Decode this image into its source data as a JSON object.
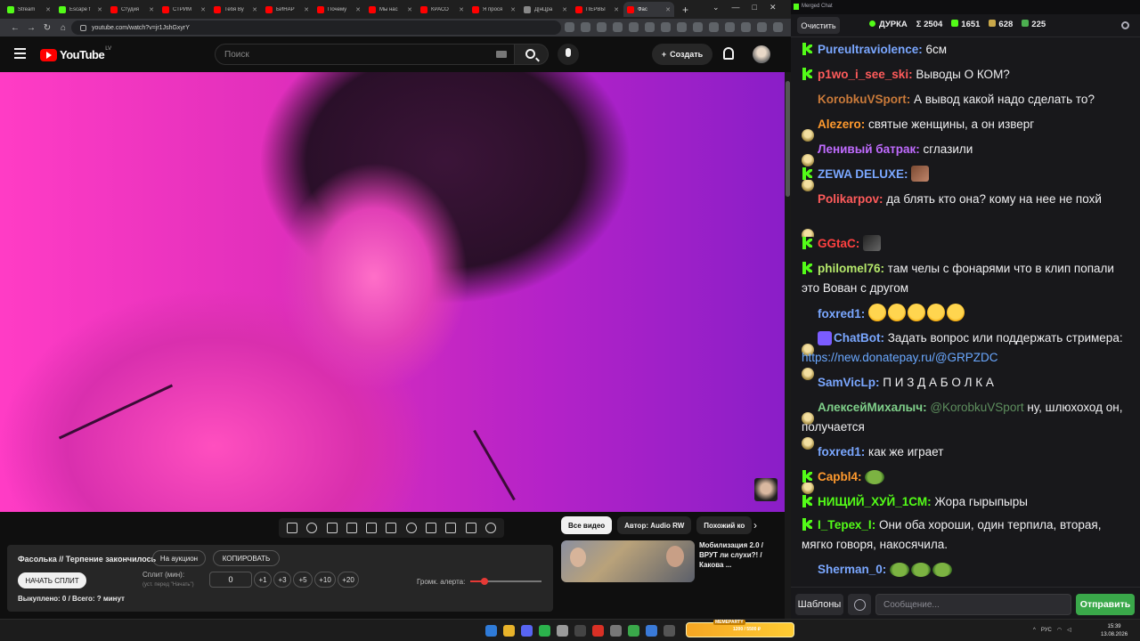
{
  "browser": {
    "tabs": [
      {
        "label": "Stream",
        "color": "#53fc18"
      },
      {
        "label": "Escape f",
        "color": "#53fc18"
      },
      {
        "label": "Студия",
        "color": "#ff0000"
      },
      {
        "label": "СТРИМ",
        "color": "#ff0000"
      },
      {
        "label": "Тебя Ву",
        "color": "#ff0000"
      },
      {
        "label": "БИНАР",
        "color": "#ff0000"
      },
      {
        "label": "Почему",
        "color": "#ff0000"
      },
      {
        "label": "Мы нас",
        "color": "#ff0000"
      },
      {
        "label": "КРАСО",
        "color": "#ff0000"
      },
      {
        "label": "Я прося",
        "color": "#ff0000"
      },
      {
        "label": "Д[нЦра",
        "color": "#888888"
      },
      {
        "label": "ПЕРВЫ",
        "color": "#ff0000"
      },
      {
        "label": "Фас",
        "color": "#ff0000",
        "active": true
      }
    ],
    "url": "youtube.com/watch?v=jr1JshGxyrY"
  },
  "youtube": {
    "logo_text": "YouTube",
    "logo_country": "LV",
    "search_placeholder": "Поиск",
    "create_label": "Создать"
  },
  "panel": {
    "title": "Фасолька // Терпение закончилось",
    "auction_label": "На аукцион",
    "copy_label": "КОПИРОВАТЬ",
    "start_split_label": "НАЧАТЬ СПЛИТ",
    "split_label": "Сплит (мин):",
    "split_hint": "(уст. перед \"Начать\")",
    "split_value": "0",
    "steps": [
      "+1",
      "+3",
      "+5",
      "+10",
      "+20"
    ],
    "alert_volume_label": "Громк. алерта:",
    "alert_volume": 0.2,
    "footer": "Выкуплено: 0 / Всего: ? минут"
  },
  "related": {
    "chips": [
      {
        "label": "Все видео",
        "active": true
      },
      {
        "label": "Автор: Audio RW",
        "active": false
      },
      {
        "label": "Похожий ко",
        "active": false
      }
    ],
    "video_title": "Мобилизация 2.0 / ВРУТ ли слухи?! / Какова ..."
  },
  "taskbar": {
    "widget_badge": "MEMEPARTY",
    "widget_text": "1200 / 5500 ₽",
    "lang": "РУС",
    "time": "15:39",
    "date": "13.08.2026"
  },
  "chat": {
    "window_title": "Merged Chat",
    "clear_label": "Очистить",
    "stats": {
      "streamer": "ДУРКА",
      "sum": "Σ 2504",
      "kick": "1651",
      "youtube": "628",
      "other": "225"
    },
    "messages": [
      {
        "platform": "kick",
        "nick": "Pureultraviolence",
        "nick_color": "#7aa7ff",
        "text": "6см"
      },
      {
        "platform": "kick",
        "nick": "p1wo_i_see_ski",
        "nick_color": "#ff5b5b",
        "text": "Выводы О КОМ?"
      },
      {
        "platform": "yt",
        "nick": "KorobkuVSport",
        "nick_color": "#c97a3a",
        "text": "А вывод какой надо сделать то?"
      },
      {
        "platform": "yt",
        "nick": "Alezero",
        "nick_color": "#ff9a2e",
        "text": "святые женщины, а он изверг"
      },
      {
        "platform": "yt",
        "nick": "Ленивый батрак",
        "nick_color": "#c06bff",
        "text": "сглазили"
      },
      {
        "platform": "kick",
        "nick": "ZEWA DELUXE",
        "nick_color": "#7aa7ff",
        "text": "",
        "emote": "emo-brown"
      },
      {
        "platform": "yt",
        "nick": "Polikarpov",
        "nick_color": "#ff5b5b",
        "text": "да блять кто она? кому на нее не похй"
      },
      {
        "platform": "kick",
        "nick": "GGtaC",
        "nick_color": "#ff4040",
        "text": "",
        "emote": "emo-dark"
      },
      {
        "platform": "kick",
        "nick": "philomel76",
        "nick_color": "#b5e86b",
        "text": "там челы с фонарями что в клип попали это Вован с другом"
      },
      {
        "platform": "yt",
        "nick": "foxred1",
        "nick_color": "#7aa7ff",
        "text": "",
        "laughs": 5
      },
      {
        "platform": "yt",
        "bot": true,
        "nick": "ChatBot",
        "nick_color": "#7aa7ff",
        "text": "Задать вопрос или поддержать стримера: ",
        "link": "https://new.donatepay.ru/@GRPZDC"
      },
      {
        "platform": "yt",
        "nick": "SamVicLp",
        "nick_color": "#7aa7ff",
        "text": "П И З Д А Б О Л К А"
      },
      {
        "platform": "yt",
        "nick": "АлексейМихалыч",
        "nick_color": "#7fd08a",
        "mention": "@KorobkuVSport",
        "text": " ну, шлюхоход он, получается"
      },
      {
        "platform": "yt",
        "nick": "foxred1",
        "nick_color": "#7aa7ff",
        "text": "как же играет"
      },
      {
        "platform": "kick",
        "nick": "Capbl4",
        "nick_color": "#ff9a2e",
        "text": "",
        "frogs": 1
      },
      {
        "platform": "kick",
        "nick": "НИЩИЙ_ХУЙ_1СМ",
        "nick_color": "#53fc18",
        "text": "Жора гырыпыры"
      },
      {
        "platform": "kick",
        "nick": "I_Терех_I",
        "nick_color": "#53fc18",
        "text": "Они оба хороши, один терпила, вторая, мягко говоря, накосячила."
      },
      {
        "platform": "yt",
        "nick": "Sherman_0",
        "nick_color": "#7aa7ff",
        "text": "",
        "frogs": 3
      }
    ],
    "templates_label": "Шаблоны",
    "input_placeholder": "Сообщение...",
    "send_label": "Отправить"
  }
}
